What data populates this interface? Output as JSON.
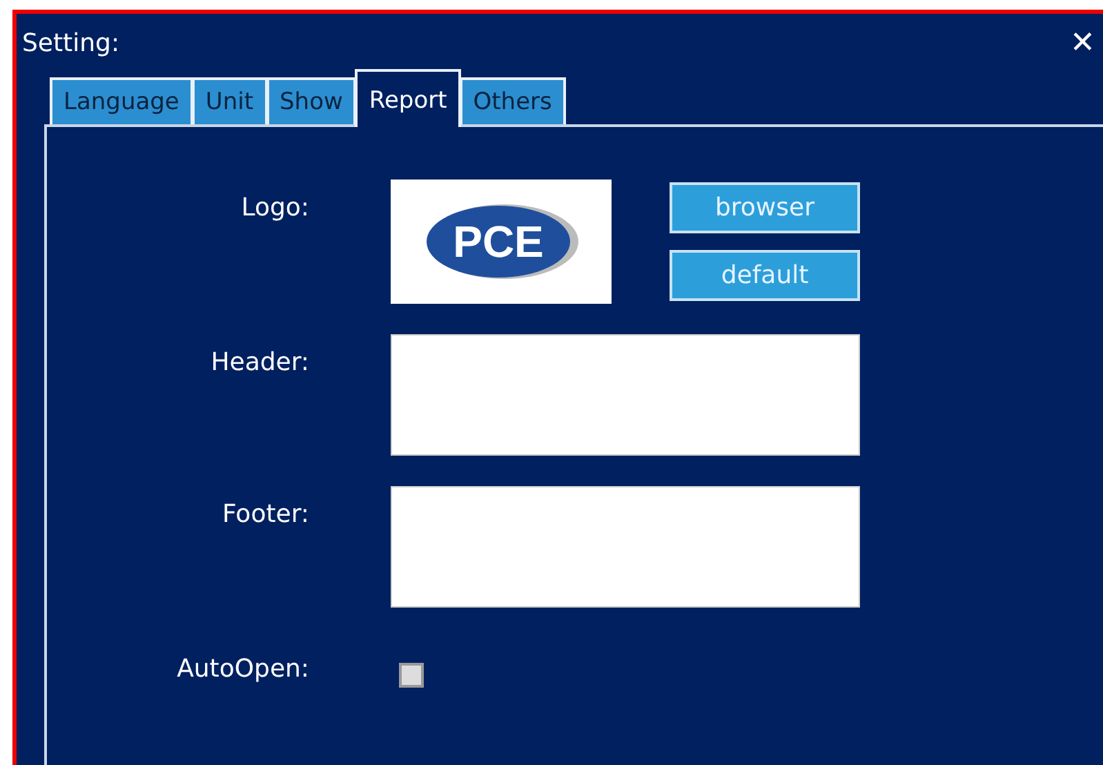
{
  "window": {
    "title": "Setting:",
    "close": "✕"
  },
  "tabs": [
    {
      "label": "Language",
      "selected": false
    },
    {
      "label": "Unit",
      "selected": false
    },
    {
      "label": "Show",
      "selected": false
    },
    {
      "label": "Report",
      "selected": true
    },
    {
      "label": "Others",
      "selected": false
    }
  ],
  "report": {
    "logo_label": "Logo:",
    "logo_text": "PCE",
    "buttons": [
      "browser",
      "default"
    ],
    "header_label": "Header:",
    "footer_label": "Footer:",
    "autoopen_label": "AutoOpen:",
    "autoopen_checked": false
  }
}
